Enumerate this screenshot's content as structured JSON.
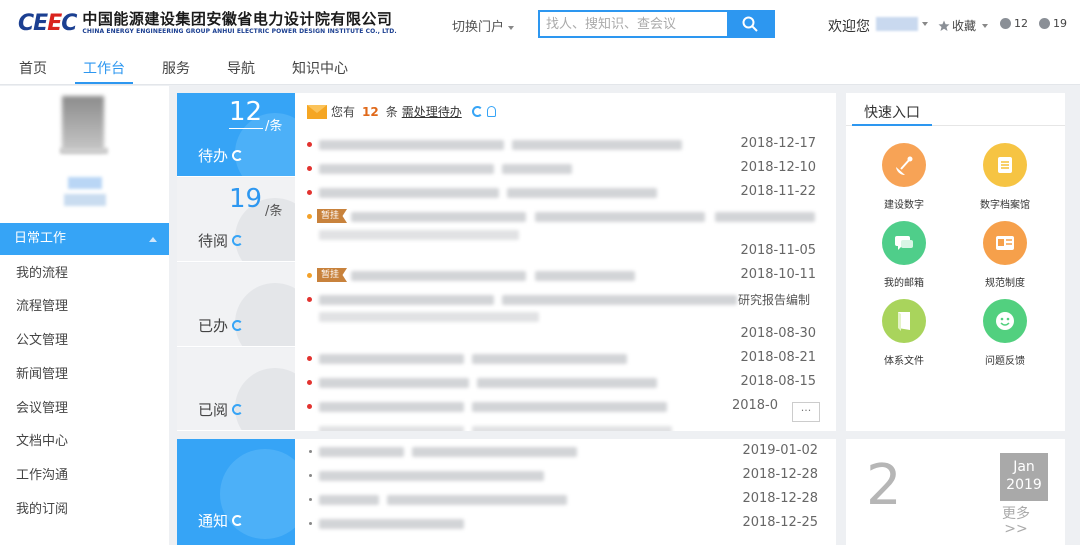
{
  "header": {
    "logo_mark": "CEEC",
    "logo_cn": "中国能源建设集团安徽省电力设计院有限公司",
    "logo_en": "CHINA ENERGY ENGINEERING GROUP ANHUI ELECTRIC POWER DESIGN INSTITUTE CO., LTD.",
    "portal_switch": "切换门户",
    "search_placeholder": "找人、搜知识、查会议",
    "welcome": "欢迎您",
    "favorites": "收藏",
    "badge_a": "12",
    "badge_b": "19"
  },
  "nav": [
    "首页",
    "工作台",
    "服务",
    "导航",
    "知识中心"
  ],
  "sidebar": {
    "section": "日常工作",
    "items": [
      "我的流程",
      "流程管理",
      "公文管理",
      "新闻管理",
      "会议管理",
      "文档中心",
      "工作沟通",
      "我的订阅"
    ]
  },
  "tabs": {
    "todo": {
      "count": "12",
      "unit": "/条",
      "label": "待办"
    },
    "toread": {
      "count": "19",
      "unit": "/条",
      "label": "待阅"
    },
    "done": {
      "label": "已办"
    },
    "read": {
      "label": "已阅"
    },
    "notice": {
      "label": "通知"
    }
  },
  "todo": {
    "prefix": "您有",
    "count": "12",
    "middle": "条",
    "link": "需处理待办",
    "pin_tag": "暂挂",
    "suffix_text": "研究报告编制",
    "more": "···",
    "dates": [
      "2018-12-17",
      "2018-12-10",
      "2018-11-22",
      "2018-11-05",
      "2018-10-11",
      "2018-08-30",
      "2018-08-21",
      "2018-08-15",
      "2018-0"
    ]
  },
  "quick": {
    "title": "快速入口",
    "items": [
      "建设数字",
      "数字档案馆",
      "我的邮箱",
      "规范制度",
      "体系文件",
      "问题反馈"
    ],
    "colors": [
      "#f7a356",
      "#f6c443",
      "#4fce8a",
      "#f6a04b",
      "#a9d45c",
      "#52d07f"
    ]
  },
  "notice": {
    "dates": [
      "2019-01-02",
      "2018-12-28",
      "2018-12-28",
      "2018-12-25"
    ]
  },
  "calendar": {
    "day": "2",
    "month": "Jan",
    "year": "2019",
    "more": "更多",
    "more_arrow": ">>"
  }
}
